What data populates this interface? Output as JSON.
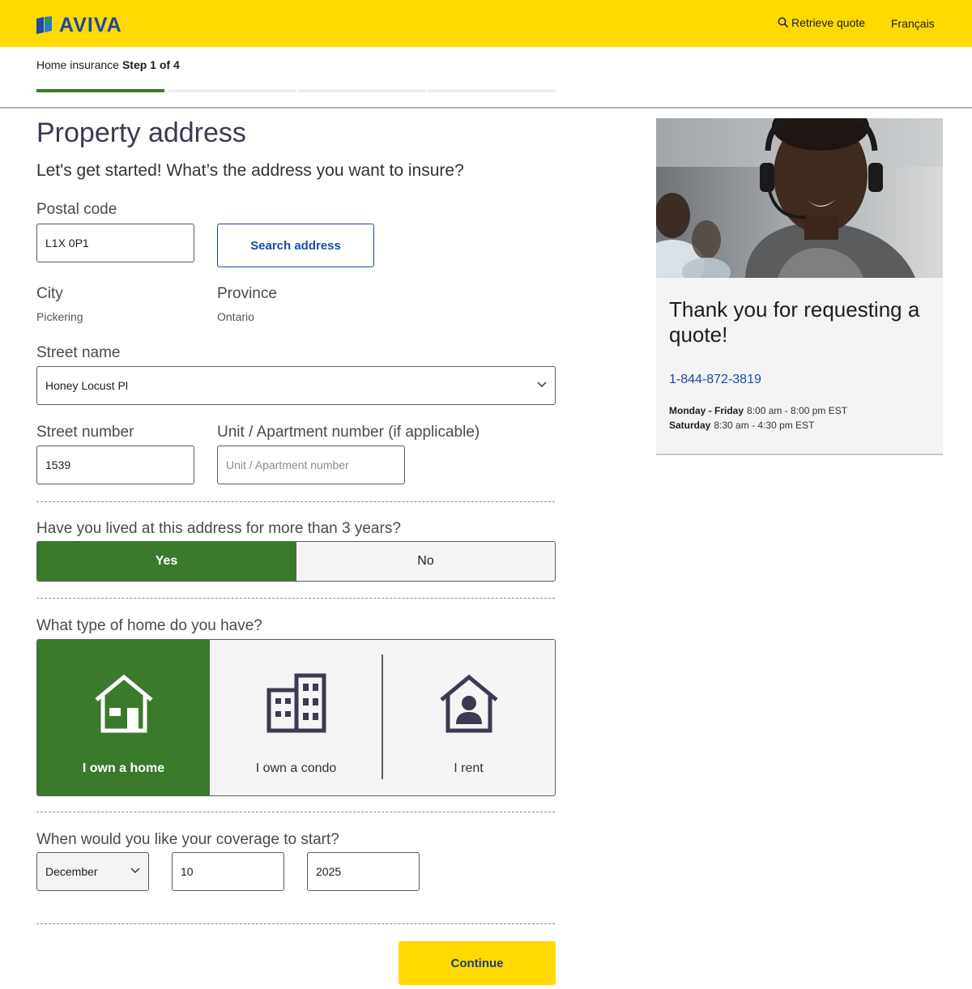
{
  "header": {
    "brand": "AVIVA",
    "retrieve_label": "Retrieve quote",
    "language_label": "Français",
    "colors": {
      "bar": "#ffd900",
      "brand": "#1c4ba0"
    }
  },
  "progress": {
    "section": "Home insurance",
    "step": "Step 1 of 4",
    "current": 1,
    "total": 4
  },
  "page": {
    "title": "Property address",
    "subtitle": "Let's get started! What’s the address you want to insure?"
  },
  "form": {
    "postal_code": {
      "label": "Postal code",
      "value": "L1X 0P1"
    },
    "search_button": "Search address",
    "city": {
      "label": "City",
      "value": "Pickering"
    },
    "province": {
      "label": "Province",
      "value": "Ontario"
    },
    "street_name": {
      "label": "Street name",
      "value": "Honey Locust Pl"
    },
    "street_number": {
      "label": "Street number",
      "value": "1539"
    },
    "unit": {
      "label": "Unit / Apartment number (if applicable)",
      "placeholder": "Unit / Apartment number"
    },
    "lived_question": {
      "label": "Have you lived at this address for more than 3 years?",
      "options": [
        "Yes",
        "No"
      ],
      "selected": "Yes"
    },
    "home_type": {
      "label": "What type of home do you have?",
      "options": [
        {
          "label": "I own a home",
          "icon": "house-icon"
        },
        {
          "label": "I own a condo",
          "icon": "condo-building-icon"
        },
        {
          "label": "I rent",
          "icon": "rent-person-house-icon"
        }
      ],
      "selected": "I own a home"
    },
    "coverage": {
      "label": "When would you like your coverage to start?",
      "month": "December",
      "day": "10",
      "year": "2025"
    },
    "continue_button": "Continue",
    "accent_color": "#3a7a2b"
  },
  "sidebar": {
    "title": "Thank you for requesting a quote!",
    "phone": "1-844-872-3819",
    "hours": [
      {
        "days": "Monday - Friday",
        "time": "8:00 am - 8:00 pm EST"
      },
      {
        "days": "Saturday",
        "time": "8:30 am - 4:30 pm EST"
      }
    ]
  }
}
